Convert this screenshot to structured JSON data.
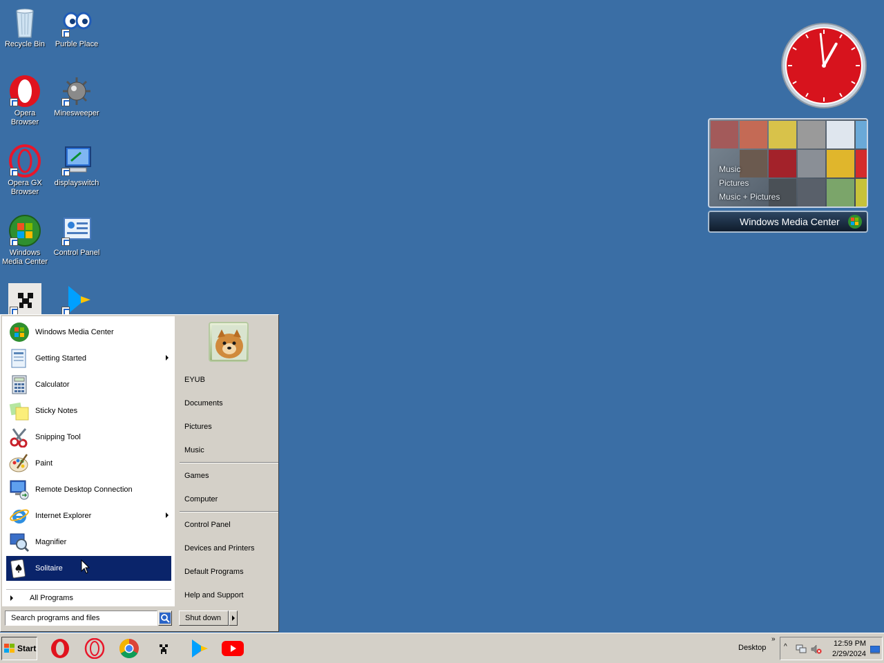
{
  "desktop": {
    "background_color": "#3a6ea5",
    "icons": [
      {
        "label": "Recycle Bin",
        "icon": "recycle-bin-icon"
      },
      {
        "label": "Purble Place",
        "icon": "purble-place-icon"
      },
      {
        "label": "Opera Browser",
        "icon": "opera-icon"
      },
      {
        "label": "Minesweeper",
        "icon": "minesweeper-icon"
      },
      {
        "label": "Opera GX Browser",
        "icon": "opera-gx-icon"
      },
      {
        "label": "displayswitch",
        "icon": "displayswitch-icon"
      },
      {
        "label": "Windows Media Center",
        "icon": "windows-media-center-icon"
      },
      {
        "label": "Control Panel",
        "icon": "control-panel-icon"
      },
      {
        "label": "",
        "icon": "minecraft-icon"
      },
      {
        "label": "",
        "icon": "google-play-icon"
      }
    ]
  },
  "gadgets": {
    "clock": {
      "hour": 12,
      "minute": 59,
      "face_color": "#d7131d"
    },
    "media_center": {
      "menu": [
        "Music",
        "Pictures",
        "Music + Pictures"
      ],
      "brand": "Windows Media Center"
    }
  },
  "start_menu": {
    "programs": [
      {
        "label": "Windows Media Center",
        "icon": "windows-media-center-icon",
        "submenu": false
      },
      {
        "label": "Getting Started",
        "icon": "getting-started-icon",
        "submenu": true
      },
      {
        "label": "Calculator",
        "icon": "calculator-icon",
        "submenu": false
      },
      {
        "label": "Sticky Notes",
        "icon": "sticky-notes-icon",
        "submenu": false
      },
      {
        "label": "Snipping Tool",
        "icon": "snipping-tool-icon",
        "submenu": false
      },
      {
        "label": "Paint",
        "icon": "paint-icon",
        "submenu": false
      },
      {
        "label": "Remote Desktop Connection",
        "icon": "remote-desktop-icon",
        "submenu": false
      },
      {
        "label": "Internet Explorer",
        "icon": "internet-explorer-icon",
        "submenu": true
      },
      {
        "label": "Magnifier",
        "icon": "magnifier-icon",
        "submenu": false
      },
      {
        "label": "Solitaire",
        "icon": "solitaire-icon",
        "submenu": false,
        "selected": true
      }
    ],
    "all_programs": "All Programs",
    "search_placeholder": "Search programs and files",
    "places": {
      "user": "EYUB",
      "documents": "Documents",
      "pictures": "Pictures",
      "music": "Music",
      "games": "Games",
      "computer": "Computer",
      "control_panel": "Control Panel",
      "devices": "Devices and Printers",
      "default_programs": "Default Programs",
      "help": "Help and Support"
    },
    "shutdown": "Shut down",
    "selection_color": "#0a246a"
  },
  "taskbar": {
    "start": "Start",
    "pinned": [
      "opera-icon",
      "opera-gx-icon",
      "chrome-icon",
      "minecraft-icon",
      "google-play-icon",
      "youtube-icon"
    ],
    "desktop_toolbar": "Desktop",
    "chevron": "»",
    "time": "12:59 PM",
    "date": "2/29/2024"
  }
}
